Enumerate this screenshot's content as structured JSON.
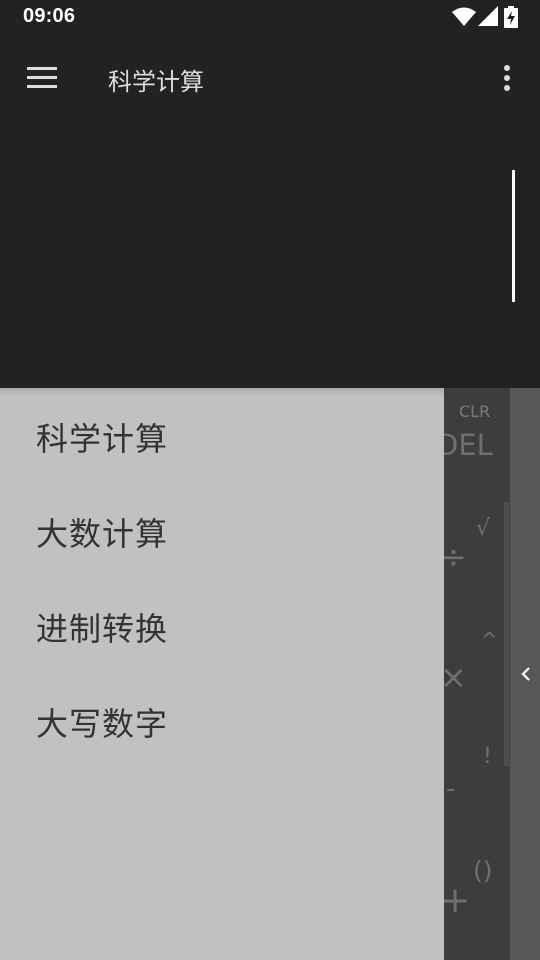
{
  "status_bar": {
    "time": "09:06",
    "icons": [
      "wifi-icon",
      "cellular-signal-icon",
      "battery-charging-icon"
    ]
  },
  "app_bar": {
    "title": "科学计算",
    "menu_icon": "hamburger-menu-icon",
    "overflow_icon": "more-vertical-icon"
  },
  "drawer": {
    "items": [
      {
        "label": "科学计算"
      },
      {
        "label": "大数计算"
      },
      {
        "label": "进制转换"
      },
      {
        "label": "大写数字"
      }
    ]
  },
  "keypad": {
    "clr": "CLR",
    "del": "DEL",
    "sqrt": "√",
    "divide": "÷",
    "power": "^",
    "times": "×",
    "factorial": "!",
    "minus": "-",
    "parentheses": "()",
    "plus": "+",
    "side_panel_icon": "chevron-left-icon"
  },
  "colors": {
    "background": "#222222",
    "drawer": "#c1c1c1",
    "keypad": "#3d3d3d",
    "side_panel": "#575757"
  }
}
